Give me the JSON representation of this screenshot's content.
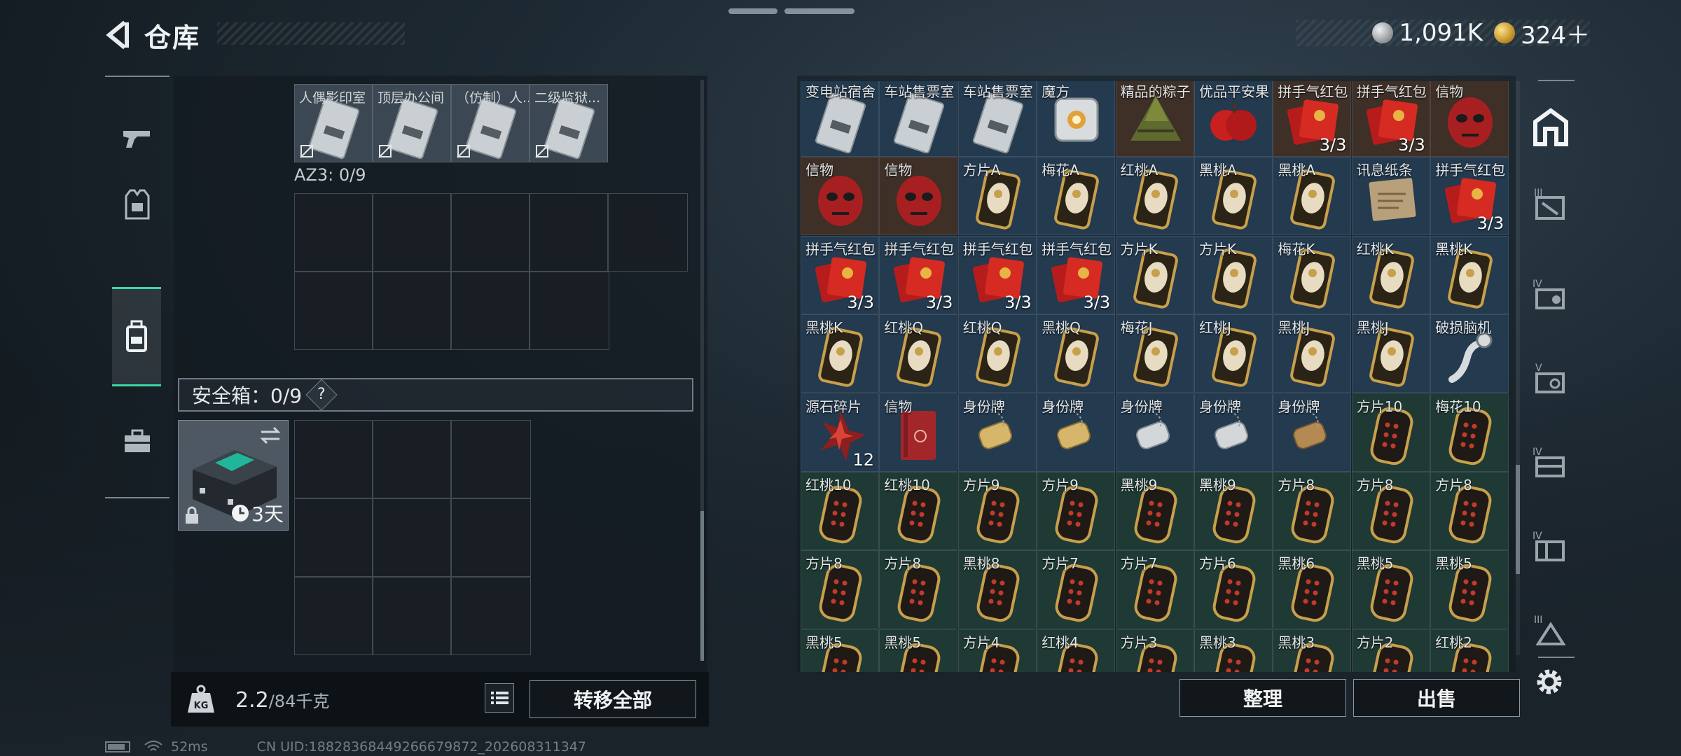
{
  "header": {
    "title": "仓库"
  },
  "currency": {
    "silver": "1,091K",
    "gold": "324＋"
  },
  "left_nav": [
    "gun-icon",
    "vest-icon",
    "backpack-icon",
    "briefcase-icon"
  ],
  "container_top": {
    "tags": [
      "人偶影印室",
      "顶层办公间",
      "（仿制）人...",
      "二级监狱..."
    ]
  },
  "az3": {
    "label": "AZ3: 0/9"
  },
  "safe_box": {
    "label": "安全箱：0/9",
    "help": "?",
    "timer": "3天"
  },
  "bottom": {
    "weight_current": "2.2",
    "weight_total": "/84千克",
    "transfer_all": "转移全部"
  },
  "actions": {
    "organize": "整理",
    "sell": "出售"
  },
  "status": {
    "ping": "52ms",
    "uid": "CN UID:18828368449266679872_202608311347"
  },
  "colors": {
    "accent": "#3fd6a4",
    "card_blue": "#233a4f",
    "card_green": "#1f3a34",
    "card_brown": "#3e2f27"
  },
  "stash": {
    "rows": [
      [
        {
          "l": "变电站宿舍",
          "t": "keycard",
          "bg": "card_blue"
        },
        {
          "l": "车站售票室",
          "t": "keycard",
          "bg": "card_blue"
        },
        {
          "l": "车站售票室",
          "t": "keycard",
          "bg": "card_blue"
        },
        {
          "l": "魔方",
          "t": "cube",
          "bg": "card_blue"
        },
        {
          "l": "精品的粽子",
          "t": "zongzi",
          "bg": "card_brown"
        },
        {
          "l": "优品平安果",
          "t": "apple",
          "bg": "card_blue"
        },
        {
          "l": "拼手气红包",
          "t": "redenv",
          "bg": "card_brown",
          "c": "3/3"
        },
        {
          "l": "拼手气红包",
          "t": "redenv",
          "bg": "card_brown",
          "c": "3/3"
        },
        {
          "l": "信物",
          "t": "mask",
          "bg": "card_brown"
        }
      ],
      [
        {
          "l": "信物",
          "t": "mask",
          "bg": "card_brown"
        },
        {
          "l": "信物",
          "t": "mask",
          "bg": "card_brown"
        },
        {
          "l": "方片A",
          "t": "pcard",
          "bg": "card_blue"
        },
        {
          "l": "梅花A",
          "t": "pcard",
          "bg": "card_blue"
        },
        {
          "l": "红桃A",
          "t": "pcard",
          "bg": "card_blue"
        },
        {
          "l": "黑桃A",
          "t": "pcard",
          "bg": "card_blue"
        },
        {
          "l": "黑桃A",
          "t": "pcard",
          "bg": "card_blue"
        },
        {
          "l": "讯息纸条",
          "t": "paper",
          "bg": "card_blue"
        },
        {
          "l": "拼手气红包",
          "t": "redenv",
          "bg": "card_blue",
          "c": "3/3"
        }
      ],
      [
        {
          "l": "拼手气红包",
          "t": "redenv",
          "bg": "card_blue",
          "c": "3/3"
        },
        {
          "l": "拼手气红包",
          "t": "redenv",
          "bg": "card_blue",
          "c": "3/3"
        },
        {
          "l": "拼手气红包",
          "t": "redenv",
          "bg": "card_blue",
          "c": "3/3"
        },
        {
          "l": "拼手气红包",
          "t": "redenv",
          "bg": "card_blue",
          "c": "3/3"
        },
        {
          "l": "方片K",
          "t": "pcard",
          "bg": "card_blue"
        },
        {
          "l": "方片K",
          "t": "pcard",
          "bg": "card_blue"
        },
        {
          "l": "梅花K",
          "t": "pcard",
          "bg": "card_blue"
        },
        {
          "l": "红桃K",
          "t": "pcard",
          "bg": "card_blue"
        },
        {
          "l": "黑桃K",
          "t": "pcard",
          "bg": "card_blue"
        }
      ],
      [
        {
          "l": "黑桃K",
          "t": "pcard",
          "bg": "card_blue"
        },
        {
          "l": "红桃Q",
          "t": "pcard",
          "bg": "card_blue"
        },
        {
          "l": "红桃Q",
          "t": "pcard",
          "bg": "card_blue"
        },
        {
          "l": "黑桃Q",
          "t": "pcard",
          "bg": "card_blue"
        },
        {
          "l": "梅花J",
          "t": "pcard",
          "bg": "card_blue"
        },
        {
          "l": "红桃J",
          "t": "pcard",
          "bg": "card_blue"
        },
        {
          "l": "黑桃J",
          "t": "pcard",
          "bg": "card_blue"
        },
        {
          "l": "黑桃J",
          "t": "pcard",
          "bg": "card_blue"
        },
        {
          "l": "破损脑机",
          "t": "brain",
          "bg": "card_blue"
        }
      ],
      [
        {
          "l": "源石碎片",
          "t": "shard",
          "bg": "card_blue",
          "c": "12"
        },
        {
          "l": "信物",
          "t": "redbook",
          "bg": "card_blue"
        },
        {
          "l": "身份牌",
          "t": "dogtag_g",
          "bg": "card_blue"
        },
        {
          "l": "身份牌",
          "t": "dogtag_g",
          "bg": "card_blue"
        },
        {
          "l": "身份牌",
          "t": "dogtag_s",
          "bg": "card_blue"
        },
        {
          "l": "身份牌",
          "t": "dogtag_s",
          "bg": "card_blue"
        },
        {
          "l": "身份牌",
          "t": "dogtag_b",
          "bg": "card_blue"
        },
        {
          "l": "方片10",
          "t": "ncard",
          "bg": "card_green"
        },
        {
          "l": "梅花10",
          "t": "ncard",
          "bg": "card_green"
        }
      ],
      [
        {
          "l": "红桃10",
          "t": "ncard",
          "bg": "card_green"
        },
        {
          "l": "红桃10",
          "t": "ncard",
          "bg": "card_green"
        },
        {
          "l": "方片9",
          "t": "ncard",
          "bg": "card_green"
        },
        {
          "l": "方片9",
          "t": "ncard",
          "bg": "card_green"
        },
        {
          "l": "黑桃9",
          "t": "ncard",
          "bg": "card_green"
        },
        {
          "l": "黑桃9",
          "t": "ncard",
          "bg": "card_green"
        },
        {
          "l": "方片8",
          "t": "ncard",
          "bg": "card_green"
        },
        {
          "l": "方片8",
          "t": "ncard",
          "bg": "card_green"
        },
        {
          "l": "方片8",
          "t": "ncard",
          "bg": "card_green"
        }
      ],
      [
        {
          "l": "方片8",
          "t": "ncard",
          "bg": "card_green"
        },
        {
          "l": "方片8",
          "t": "ncard",
          "bg": "card_green"
        },
        {
          "l": "黑桃8",
          "t": "ncard",
          "bg": "card_green"
        },
        {
          "l": "方片7",
          "t": "ncard",
          "bg": "card_green"
        },
        {
          "l": "方片7",
          "t": "ncard",
          "bg": "card_green"
        },
        {
          "l": "方片6",
          "t": "ncard",
          "bg": "card_green"
        },
        {
          "l": "黑桃6",
          "t": "ncard",
          "bg": "card_green"
        },
        {
          "l": "黑桃5",
          "t": "ncard",
          "bg": "card_green"
        },
        {
          "l": "黑桃5",
          "t": "ncard",
          "bg": "card_green"
        }
      ],
      [
        {
          "l": "黑桃5",
          "t": "ncard",
          "bg": "card_green"
        },
        {
          "l": "黑桃5",
          "t": "ncard",
          "bg": "card_green"
        },
        {
          "l": "方片4",
          "t": "ncard",
          "bg": "card_green"
        },
        {
          "l": "红桃4",
          "t": "ncard",
          "bg": "card_green"
        },
        {
          "l": "方片3",
          "t": "ncard",
          "bg": "card_green"
        },
        {
          "l": "黑桃3",
          "t": "ncard",
          "bg": "card_green"
        },
        {
          "l": "黑桃3",
          "t": "ncard",
          "bg": "card_green"
        },
        {
          "l": "方片2",
          "t": "ncard",
          "bg": "card_green"
        },
        {
          "l": "红桃2",
          "t": "ncard",
          "bg": "card_green"
        }
      ]
    ]
  }
}
